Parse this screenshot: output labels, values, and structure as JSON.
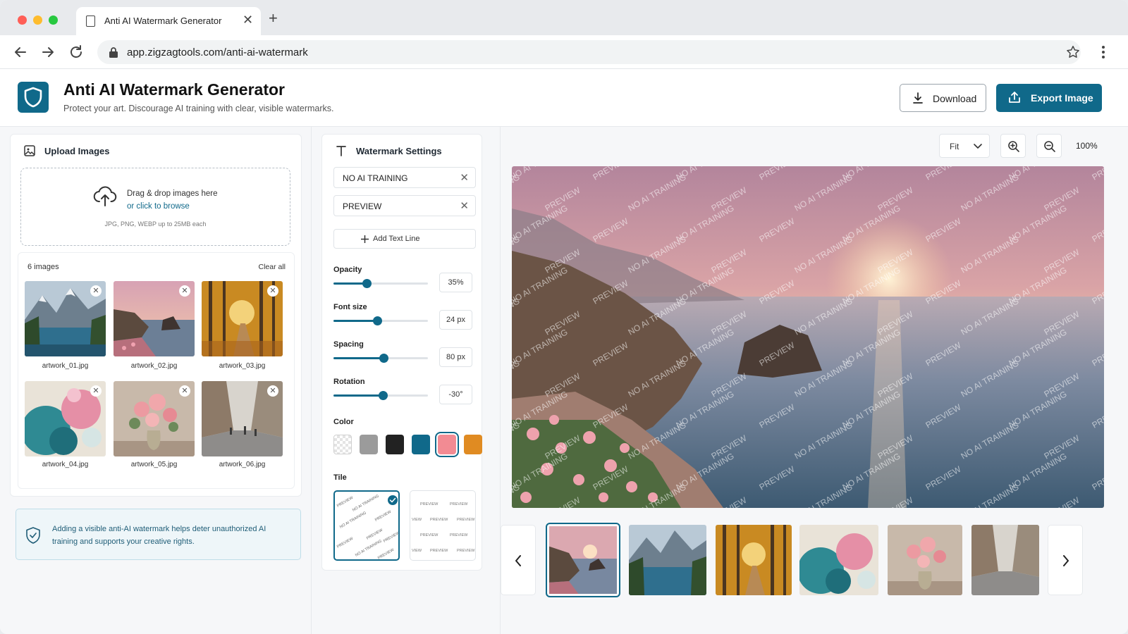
{
  "browser": {
    "tab_title": "Anti AI Watermark Generator",
    "url": "app.zigzagtools.com/anti-ai-watermark"
  },
  "header": {
    "title": "Anti AI Watermark Generator",
    "subtitle": "Protect your art. Discourage AI training with clear, visible watermarks.",
    "download_label": "Download",
    "export_label": "Export Image"
  },
  "upload": {
    "title": "Upload Images",
    "drop_line1": "Drag & drop images here",
    "drop_line2": "or click to browse",
    "drop_hint": "JPG, PNG, WEBP up to 25MB each",
    "count_label": "6 images",
    "clear_label": "Clear all",
    "files": [
      {
        "name": "artwork_01.jpg"
      },
      {
        "name": "artwork_02.jpg"
      },
      {
        "name": "artwork_03.jpg"
      },
      {
        "name": "artwork_04.jpg"
      },
      {
        "name": "artwork_05.jpg"
      },
      {
        "name": "artwork_06.jpg"
      }
    ]
  },
  "info": {
    "text": "Adding a visible anti-AI watermark helps deter unauthorized AI training and supports your creative rights."
  },
  "settings": {
    "title": "Watermark Settings",
    "text_lines": [
      "NO AI TRAINING",
      "PREVIEW"
    ],
    "add_line_label": "Add Text Line",
    "opacity": {
      "label": "Opacity",
      "value": "35%",
      "level": 0.35
    },
    "font_size": {
      "label": "Font size",
      "value": "24 px",
      "level": 0.46
    },
    "spacing": {
      "label": "Spacing",
      "value": "80 px",
      "level": 0.53
    },
    "rotation": {
      "label": "Rotation",
      "value": "-30°",
      "level": 0.52
    },
    "color_label": "Color",
    "colors": [
      "#d9d9d9",
      "#9b9b9b",
      "#222222",
      "#10698a",
      "#f28b93",
      "#e08b22"
    ],
    "selected_color": "#f28b93",
    "tile_label": "Tile",
    "tile_text_1": "PREVIEW",
    "tile_text_2": "NO AI TRAINING",
    "tile_text_3": "VIEW"
  },
  "preview": {
    "fit_label": "Fit",
    "zoom_level": "100%",
    "watermark_1": "NO AI TRAINING",
    "watermark_2": "PREVIEW"
  },
  "colors": {
    "accent": "#10698a"
  }
}
